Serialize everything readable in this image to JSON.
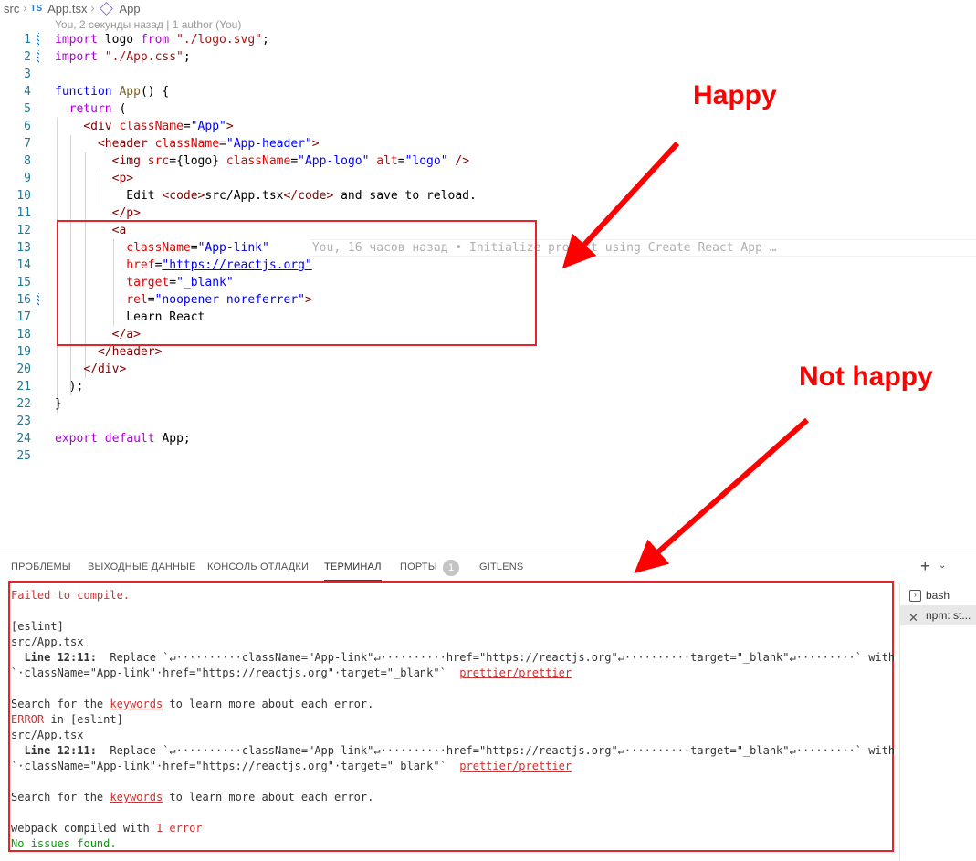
{
  "breadcrumb": {
    "folder": "src",
    "lang_badge": "TS",
    "file": "App.tsx",
    "symbol": "App"
  },
  "blame_top": "You, 2 секунды назад | 1 author (You)",
  "code_lines": [
    {
      "n": "1"
    },
    {
      "n": "2"
    },
    {
      "n": "3"
    },
    {
      "n": "4"
    },
    {
      "n": "5"
    },
    {
      "n": "6"
    },
    {
      "n": "7"
    },
    {
      "n": "8"
    },
    {
      "n": "9"
    },
    {
      "n": "10"
    },
    {
      "n": "11"
    },
    {
      "n": "12"
    },
    {
      "n": "13"
    },
    {
      "n": "14"
    },
    {
      "n": "15"
    },
    {
      "n": "16"
    },
    {
      "n": "17"
    },
    {
      "n": "18"
    },
    {
      "n": "19"
    },
    {
      "n": "20"
    },
    {
      "n": "21"
    },
    {
      "n": "22"
    },
    {
      "n": "23"
    },
    {
      "n": "24"
    },
    {
      "n": "25"
    }
  ],
  "code": {
    "l1a": "import",
    "l1b": " logo ",
    "l1c": "from",
    "l1d": " \"./logo.svg\"",
    "l1e": ";",
    "l2a": "import",
    "l2b": " \"./App.css\"",
    "l2c": ";",
    "l4a": "function",
    "l4b": " App",
    "l4c": "() {",
    "l5a": "return",
    "l5b": " (",
    "l6a": "<div",
    "l6b": " className",
    "l6c": "=",
    "l6d": "\"App\"",
    "l6e": ">",
    "l7a": "<header",
    "l7b": " className",
    "l7c": "=",
    "l7d": "\"App-header\"",
    "l7e": ">",
    "l8a": "<img",
    "l8b": " src",
    "l8c": "={logo}",
    "l8d": " className",
    "l8e": "=",
    "l8f": "\"App-logo\"",
    "l8g": " alt",
    "l8h": "=",
    "l8i": "\"logo\"",
    "l8j": " />",
    "l9a": "<p>",
    "l10a": "Edit ",
    "l10b": "<code>",
    "l10c": "src/App.tsx",
    "l10d": "</code>",
    "l10e": " and save to reload.",
    "l11a": "</p>",
    "l12a": "<a",
    "l13a": "className",
    "l13b": "=",
    "l13c": "\"App-link\"",
    "l13_blame": "You, 16 часов назад • Initialize project using Create React App …",
    "l14a": "href",
    "l14b": "=",
    "l14c": "\"https://reactjs.org\"",
    "l15a": "target",
    "l15b": "=",
    "l15c": "\"_blank\"",
    "l16a": "rel",
    "l16b": "=",
    "l16c": "\"noopener noreferrer\"",
    "l16d": ">",
    "l17a": "Learn React",
    "l18a": "</a>",
    "l19a": "</header>",
    "l20a": "</div>",
    "l21a": ");",
    "l22a": "}",
    "l24a": "export",
    "l24b": " default",
    "l24c": " App;"
  },
  "annotations": {
    "happy": "Happy",
    "not_happy": "Not happy"
  },
  "panel": {
    "tabs": [
      "ПРОБЛЕМЫ",
      "ВЫХОДНЫЕ ДАННЫЕ",
      "КОНСОЛЬ ОТЛАДКИ",
      "ТЕРМИНАЛ",
      "ПОРТЫ",
      "GITLENS"
    ],
    "ports_badge": "1",
    "active_tab": "ТЕРМИНАЛ",
    "plus": "+",
    "terminals": [
      "bash",
      "npm: st..."
    ]
  },
  "terminal": {
    "failed": "Failed to compile.",
    "eslint": "[eslint]",
    "file": "src/App.tsx",
    "line_label": "  Line 12:11:",
    "replace_text": "  Replace `↵··········className=\"App-link\"↵··········href=\"https://reactjs.org\"↵··········target=\"_blank\"↵·········` with",
    "with_text": "`·className=\"App-link\"·href=\"https://reactjs.org\"·target=\"_blank\"`  ",
    "rule": "prettier/prettier",
    "search_pre": "Search for the ",
    "keywords": "keywords",
    "search_post": " to learn more about each error.",
    "error_word": "ERROR",
    "error_rest": " in [eslint]",
    "webpack_pre": "webpack compiled with ",
    "webpack_err": "1 error",
    "no_issues": "No issues found."
  },
  "colors": {
    "annotation_red": "#ff0000",
    "keyword_blue": "#0000ff",
    "error_red": "#cd3131"
  }
}
